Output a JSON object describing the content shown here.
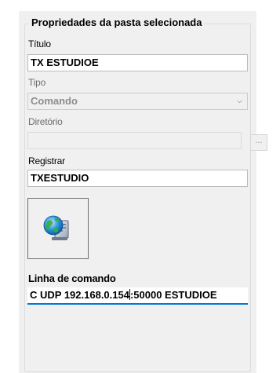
{
  "group": {
    "title": "Propriedades da pasta selecionada"
  },
  "titulo": {
    "label": "Título",
    "value": "TX ESTUDIOE"
  },
  "tipo": {
    "label": "Tipo",
    "value": "Comando",
    "icon": "chevron-down-icon"
  },
  "diretorio": {
    "label": "Diretório",
    "value": "",
    "browse_label": "..."
  },
  "registrar": {
    "label": "Registrar",
    "value": "TXESTUDIO"
  },
  "icon": {
    "name": "network-computer-icon"
  },
  "linha": {
    "label": "Linha de comando",
    "value_before_caret": "C UDP 192.168.0.154",
    "value_after_caret": ":50000 ESTUDIOE"
  }
}
